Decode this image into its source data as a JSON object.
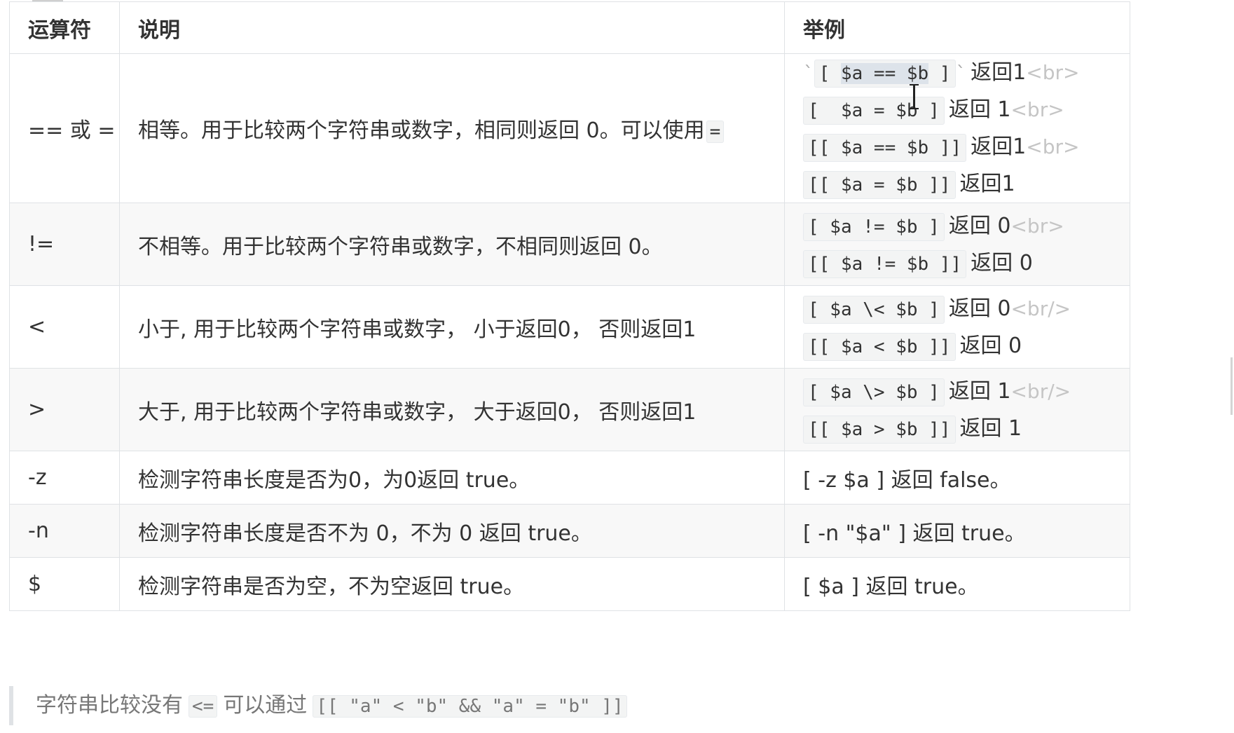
{
  "header": {
    "col_operator": "运算符",
    "col_description": "说明",
    "col_example": "举例"
  },
  "rows": [
    {
      "operator": "== 或 =",
      "description": "相等。用于比较两个字符串或数字，相同则返回 0。可以使用",
      "description_code": "=",
      "examples": [
        {
          "prefix": "`",
          "code_before": "[ ",
          "code_selected": "$a == $b",
          "code_after": " ]",
          "suffix": "`",
          "result": "返回1",
          "tag": "<br>"
        },
        {
          "code": "[  $a = $b ]",
          "result": "返回 1",
          "tag": "<br>"
        },
        {
          "code": "[[ $a == $b ]]",
          "result": "返回1",
          "tag": "<br>"
        },
        {
          "code": "[[ $a = $b ]]",
          "result": "返回1",
          "tag": ""
        }
      ]
    },
    {
      "operator": "!=",
      "description": "不相等。用于比较两个字符串或数字，不相同则返回 0。",
      "examples": [
        {
          "code": "[ $a != $b ]",
          "result": "返回 0",
          "tag": "<br>"
        },
        {
          "code": "[[ $a != $b ]]",
          "result": "返回 0",
          "tag": ""
        }
      ]
    },
    {
      "operator": "<",
      "description": "小于, 用于比较两个字符串或数字， 小于返回0， 否则返回1",
      "examples": [
        {
          "code": "[ $a \\< $b ]",
          "result": "返回 0",
          "tag": "<br/>"
        },
        {
          "code": "[[ $a < $b ]]",
          "result": "返回 0",
          "tag": ""
        }
      ]
    },
    {
      "operator": ">",
      "description": "大于, 用于比较两个字符串或数字， 大于返回0， 否则返回1",
      "examples": [
        {
          "code": "[ $a \\> $b ]",
          "result": "返回 1",
          "tag": "<br/>"
        },
        {
          "code": "[[ $a > $b ]]",
          "result": "返回 1",
          "tag": ""
        }
      ]
    },
    {
      "operator": "-z",
      "description": "检测字符串长度是否为0，为0返回 true。",
      "example_text": "[ -z $a ] 返回 false。"
    },
    {
      "operator": "-n",
      "description": "检测字符串长度是否不为 0，不为 0 返回 true。",
      "example_text": "[ -n \"$a\" ] 返回 true。"
    },
    {
      "operator": "$",
      "description": "检测字符串是否为空，不为空返回 true。",
      "example_text": "[ $a ] 返回 true。"
    }
  ],
  "note": {
    "text_before": "字符串比较没有",
    "code_1": "<=",
    "text_middle": "可以通过",
    "code_2": "[[ \"a\" < \"b\" && \"a\" = \"b\" ]]"
  }
}
